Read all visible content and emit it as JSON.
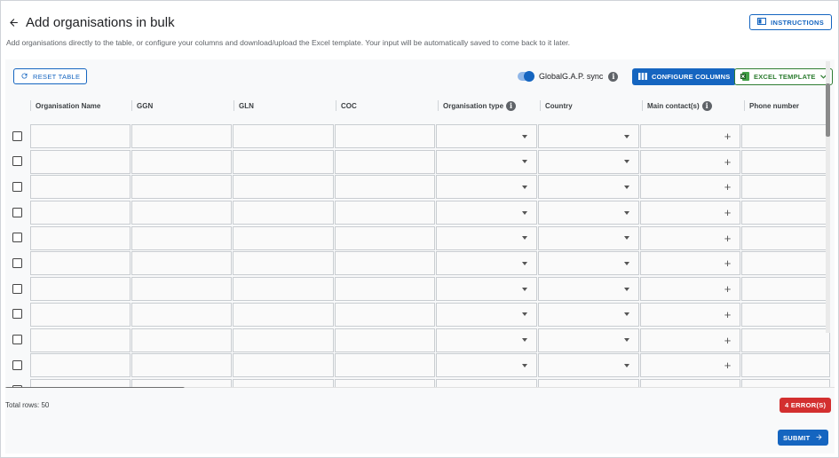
{
  "header": {
    "title": "Add organisations in bulk",
    "subtitle": "Add organisations directly to the table, or configure your columns and download/upload the Excel template. Your input will be automatically saved to come back to it later.",
    "instructions_label": "INSTRUCTIONS"
  },
  "toolbar": {
    "reset_label": "RESET TABLE",
    "sync_label": "GlobalG.A.P. sync",
    "sync_enabled": true,
    "configure_label": "CONFIGURE COLUMNS",
    "excel_label": "EXCEL TEMPLATE"
  },
  "table": {
    "columns": [
      {
        "label": "Organisation Name",
        "info": false,
        "type": "text"
      },
      {
        "label": "GGN",
        "info": false,
        "type": "text"
      },
      {
        "label": "GLN",
        "info": false,
        "type": "text"
      },
      {
        "label": "COC",
        "info": false,
        "type": "text"
      },
      {
        "label": "Organisation type",
        "info": true,
        "type": "select"
      },
      {
        "label": "Country",
        "info": false,
        "type": "select"
      },
      {
        "label": "Main contact(s)",
        "info": true,
        "type": "add"
      },
      {
        "label": "Phone number",
        "info": false,
        "type": "text"
      }
    ]
  },
  "footer": {
    "total_rows": "Total rows: 50",
    "errors_label": "4 ERROR(S)",
    "submit_label": "SUBMIT"
  },
  "colors": {
    "primary": "#1565c0",
    "error": "#d32f2f",
    "excel": "#2e7d32"
  }
}
